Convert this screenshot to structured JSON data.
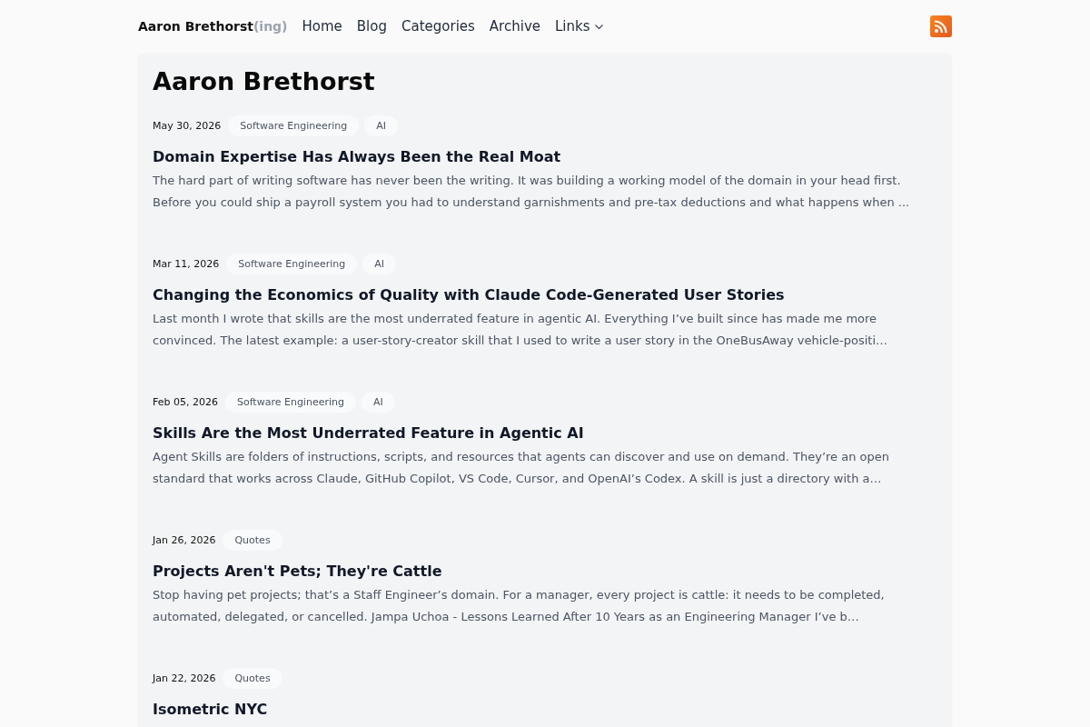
{
  "header": {
    "brand": {
      "name": "Aaron Brethorst",
      "suffix": "(ing)"
    },
    "nav": [
      {
        "label": "Home",
        "kind": "link"
      },
      {
        "label": "Blog",
        "kind": "link"
      },
      {
        "label": "Categories",
        "kind": "link"
      },
      {
        "label": "Archive",
        "kind": "link"
      },
      {
        "label": "Links",
        "kind": "dropdown"
      }
    ]
  },
  "page": {
    "title": "Aaron Brethorst"
  },
  "posts": [
    {
      "date": "May 30, 2026",
      "tags": [
        "Software Engineering",
        "AI"
      ],
      "title": "Domain Expertise Has Always Been the Real Moat",
      "excerpt": "The hard part of writing software has never been the writing. It was building a working model of the domain in your head first. Before you could ship a payroll system you had to understand garnishments and pre-tax deductions and what happens when ..."
    },
    {
      "date": "Mar 11, 2026",
      "tags": [
        "Software Engineering",
        "AI"
      ],
      "title": "Changing the Economics of Quality with Claude Code-Generated User Stories",
      "excerpt": "Last month I wrote that skills are the most underrated feature in agentic AI. Everything I’ve built since has made me more convinced. The latest example: a user-story-creator skill that I used to write a user story in the OneBusAway vehicle-positi…"
    },
    {
      "date": "Feb 05, 2026",
      "tags": [
        "Software Engineering",
        "AI"
      ],
      "title": "Skills Are the Most Underrated Feature in Agentic AI",
      "excerpt": "Agent Skills are folders of instructions, scripts, and resources that agents can discover and use on demand. They’re an open standard that works across Claude, GitHub Copilot, VS Code, Cursor, and OpenAI’s Codex. A skill is just a directory with a…"
    },
    {
      "date": "Jan 26, 2026",
      "tags": [
        "Quotes"
      ],
      "title": "Projects Aren't Pets; They're Cattle",
      "excerpt": "Stop having pet projects; that’s a Staff Engineer’s domain. For a manager, every project is cattle: it needs to be completed, automated, delegated, or cancelled. Jampa Uchoa - Lessons Learned After 10 Years as an Engineering Manager I’ve b…"
    },
    {
      "date": "Jan 22, 2026",
      "tags": [
        "Quotes"
      ],
      "title": "Isometric NYC"
    }
  ]
}
